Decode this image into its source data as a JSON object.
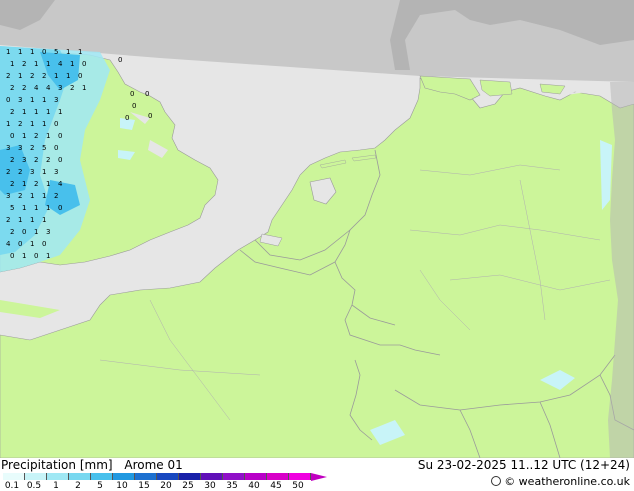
{
  "legend": {
    "title": "Precipitation [mm]",
    "model": "Arome 01",
    "datetime": "Su 23-02-2025 11..12 UTC (12+24)",
    "credit": "© weatheronline.co.uk",
    "scale_labels": [
      "0.1",
      "0.5",
      "1",
      "2",
      "5",
      "10",
      "15",
      "20",
      "25",
      "30",
      "35",
      "40",
      "45",
      "50"
    ],
    "scale_colors": [
      "#e8fcfc",
      "#c8f4f8",
      "#a0e8f4",
      "#78d8f0",
      "#48c0ec",
      "#2098e0",
      "#1c70d0",
      "#1848c0",
      "#1820a8",
      "#6010b8",
      "#9010c8",
      "#b800c8",
      "#d800c8",
      "#f000e0"
    ]
  },
  "map": {
    "colors": {
      "sea": "#e6e6e6",
      "land_in_domain": "#ccf59a",
      "land_outside": "#b4b4b4",
      "outside_sea": "#c8c8c8",
      "borders": "#9a9a9a"
    },
    "precip_values": [
      {
        "v": "1"
      },
      {
        "v": "1"
      },
      {
        "v": "1"
      },
      {
        "v": "0"
      },
      {
        "v": "5"
      },
      {
        "v": "1"
      },
      {
        "v": "1"
      },
      {
        "v": "1"
      },
      {
        "v": "2"
      },
      {
        "v": "1"
      },
      {
        "v": "1"
      },
      {
        "v": "4"
      },
      {
        "v": "1"
      },
      {
        "v": "0"
      },
      {
        "v": "2"
      },
      {
        "v": "1"
      },
      {
        "v": "2"
      },
      {
        "v": "2"
      },
      {
        "v": "1"
      },
      {
        "v": "1"
      },
      {
        "v": "0"
      },
      {
        "v": "2"
      },
      {
        "v": "2"
      },
      {
        "v": "4"
      },
      {
        "v": "4"
      },
      {
        "v": "3"
      },
      {
        "v": "2"
      },
      {
        "v": "1"
      },
      {
        "v": "0"
      },
      {
        "v": "3"
      },
      {
        "v": "1"
      },
      {
        "v": "1"
      },
      {
        "v": "3"
      },
      {
        "v": "2"
      },
      {
        "v": "1"
      },
      {
        "v": "1"
      },
      {
        "v": "1"
      },
      {
        "v": "1"
      },
      {
        "v": "1"
      },
      {
        "v": "2"
      },
      {
        "v": "1"
      },
      {
        "v": "1"
      },
      {
        "v": "0"
      },
      {
        "v": "0"
      },
      {
        "v": "1"
      },
      {
        "v": "2"
      },
      {
        "v": "1"
      },
      {
        "v": "0"
      },
      {
        "v": "3"
      },
      {
        "v": "3"
      },
      {
        "v": "2"
      },
      {
        "v": "5"
      },
      {
        "v": "0"
      },
      {
        "v": "2"
      },
      {
        "v": "3"
      },
      {
        "v": "2"
      },
      {
        "v": "2"
      },
      {
        "v": "0"
      },
      {
        "v": "2"
      },
      {
        "v": "2"
      },
      {
        "v": "3"
      },
      {
        "v": "1"
      },
      {
        "v": "3"
      },
      {
        "v": "2"
      },
      {
        "v": "1"
      },
      {
        "v": "2"
      },
      {
        "v": "1"
      },
      {
        "v": "4"
      },
      {
        "v": "3"
      },
      {
        "v": "2"
      },
      {
        "v": "1"
      },
      {
        "v": "1"
      },
      {
        "v": "2"
      },
      {
        "v": "5"
      },
      {
        "v": "1"
      },
      {
        "v": "1"
      },
      {
        "v": "1"
      },
      {
        "v": "0"
      },
      {
        "v": "2"
      },
      {
        "v": "1"
      },
      {
        "v": "1"
      },
      {
        "v": "1"
      },
      {
        "v": "2"
      },
      {
        "v": "0"
      },
      {
        "v": "1"
      },
      {
        "v": "3"
      },
      {
        "v": "4"
      },
      {
        "v": "0"
      },
      {
        "v": "1"
      },
      {
        "v": "0"
      },
      {
        "v": "0"
      },
      {
        "v": "1"
      },
      {
        "v": "0"
      },
      {
        "v": "1"
      },
      {
        "v": "0"
      },
      {
        "v": "0"
      },
      {
        "v": "0"
      },
      {
        "v": "0"
      },
      {
        "v": "0"
      },
      {
        "v": "0"
      }
    ]
  }
}
